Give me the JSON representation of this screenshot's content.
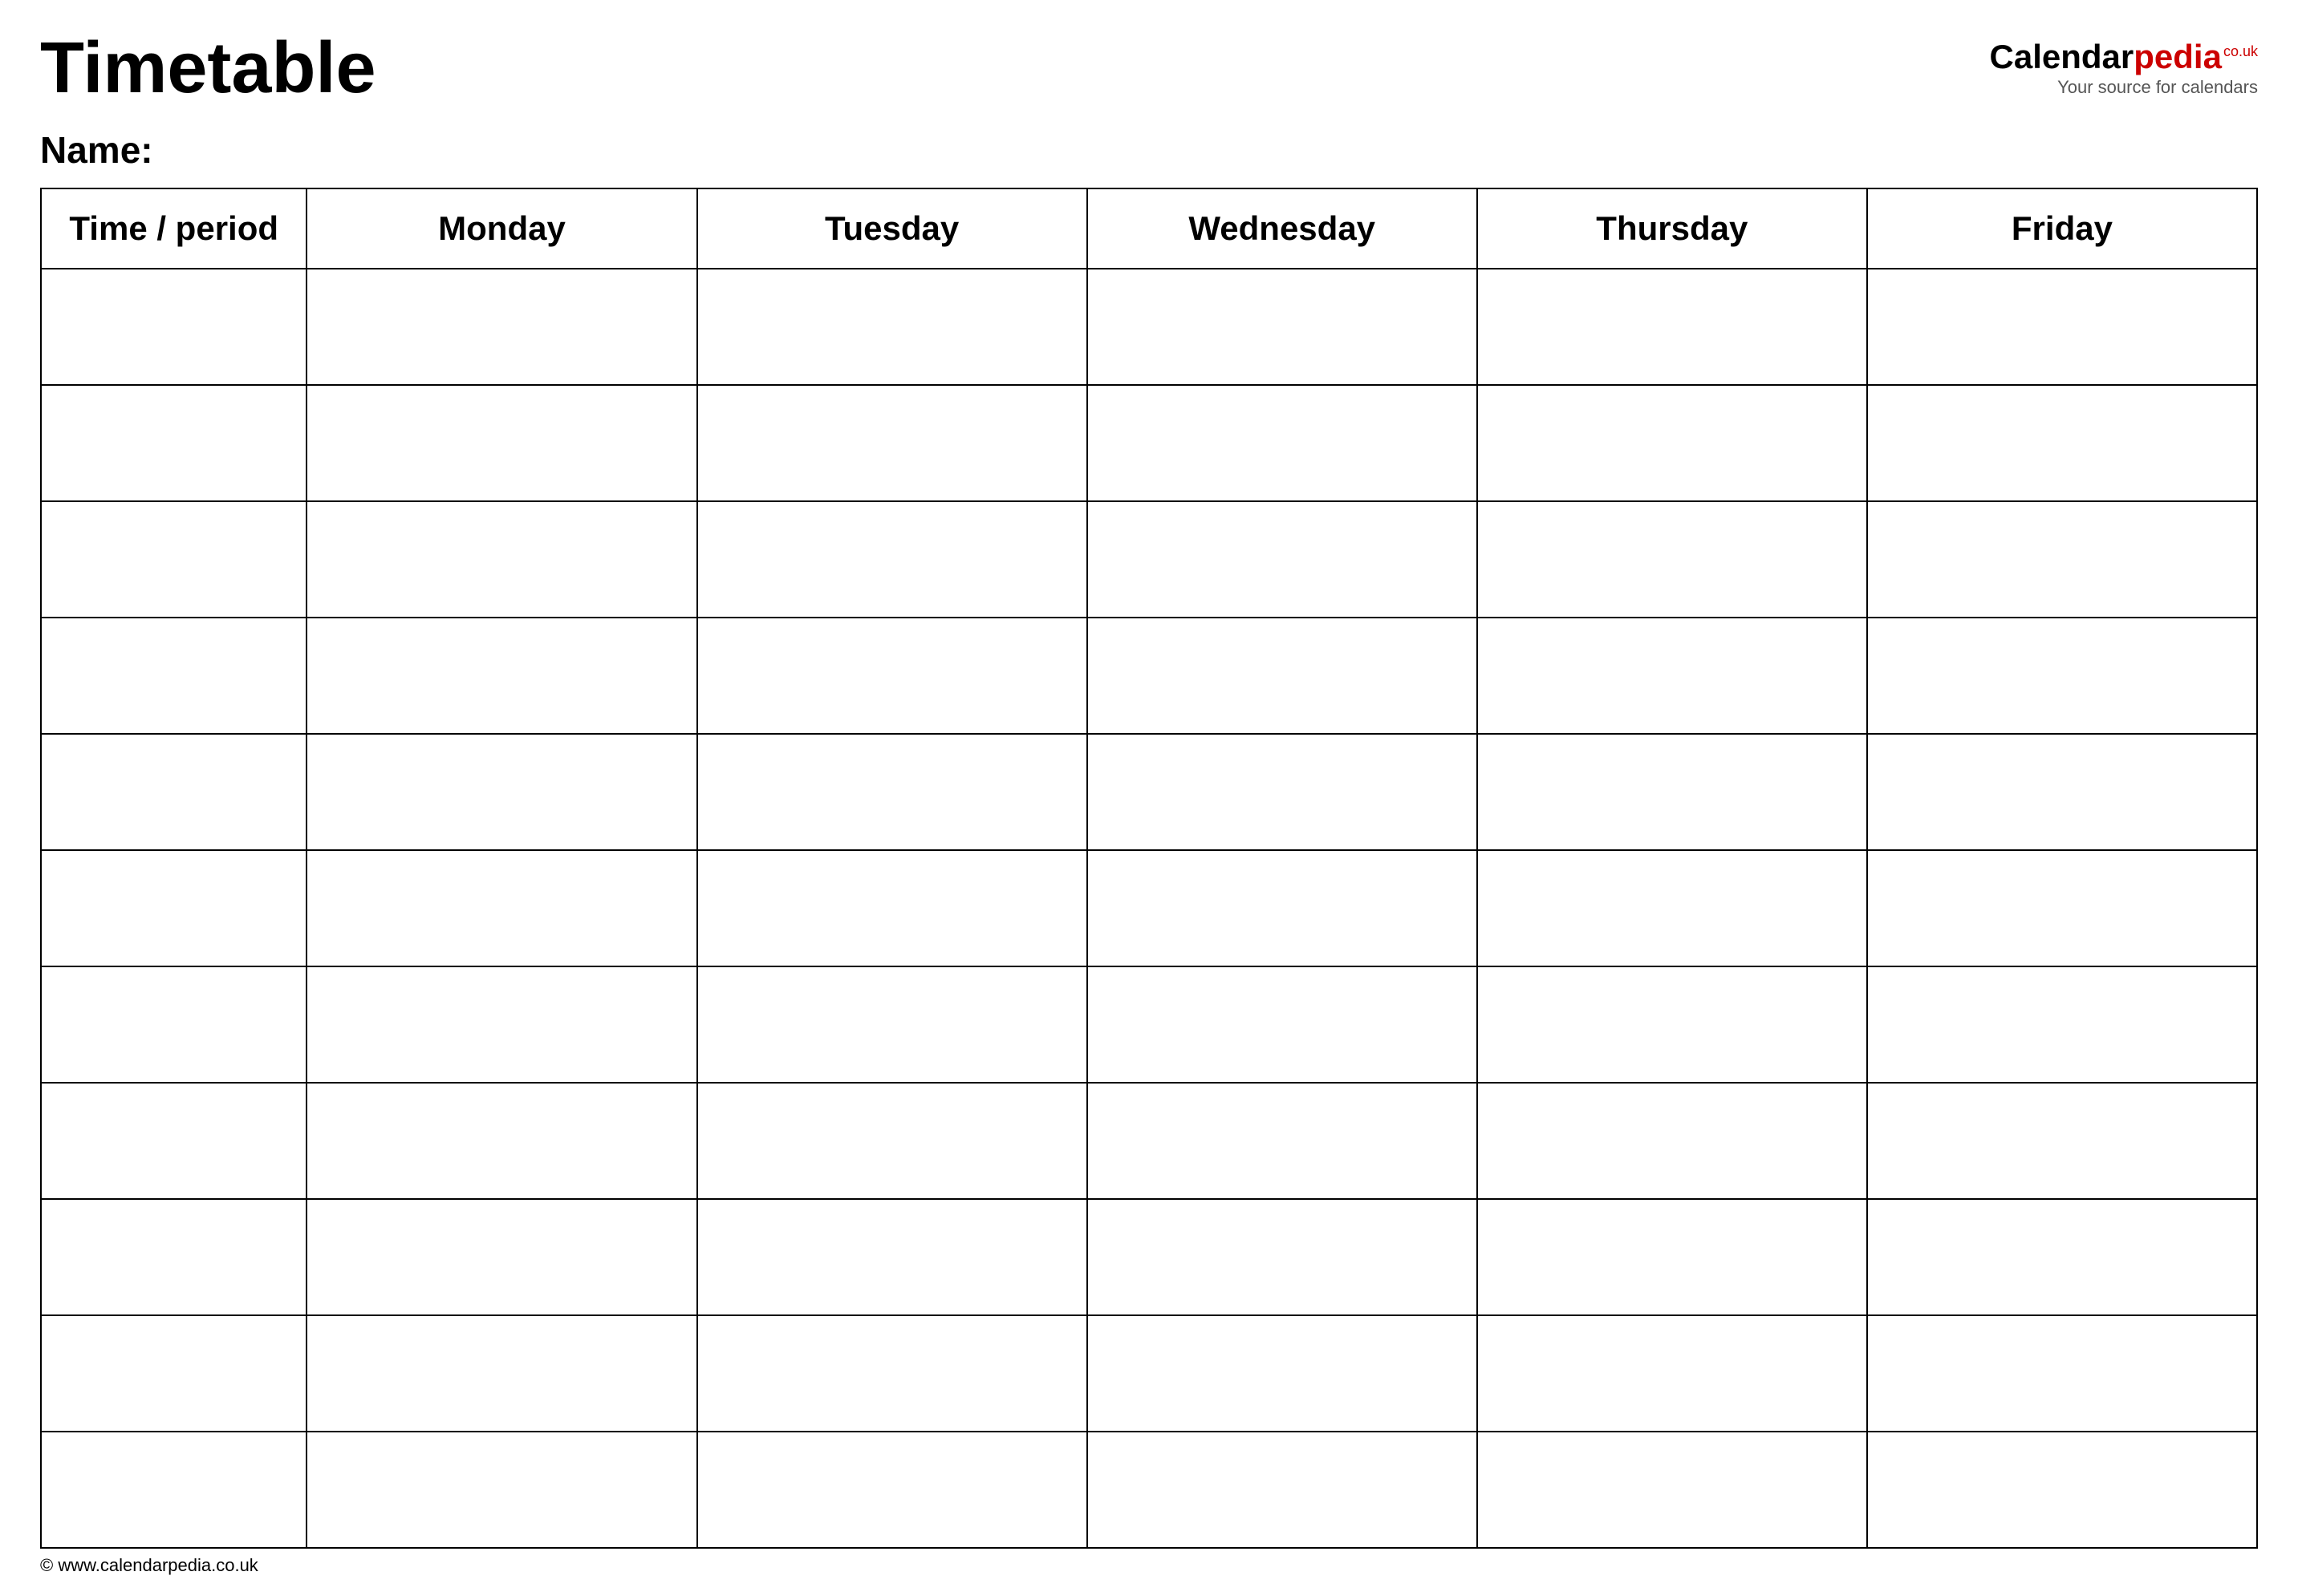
{
  "header": {
    "title": "Timetable",
    "logo": {
      "calendar": "Calendar",
      "pedia": "pedia",
      "tld": "co.uk",
      "tagline": "Your source for calendars"
    }
  },
  "name_label": "Name:",
  "table": {
    "columns": [
      {
        "label": "Time / period",
        "key": "time"
      },
      {
        "label": "Monday",
        "key": "monday"
      },
      {
        "label": "Tuesday",
        "key": "tuesday"
      },
      {
        "label": "Wednesday",
        "key": "wednesday"
      },
      {
        "label": "Thursday",
        "key": "thursday"
      },
      {
        "label": "Friday",
        "key": "friday"
      }
    ],
    "rows": 11
  },
  "footer": {
    "url": "© www.calendarpedia.co.uk"
  }
}
